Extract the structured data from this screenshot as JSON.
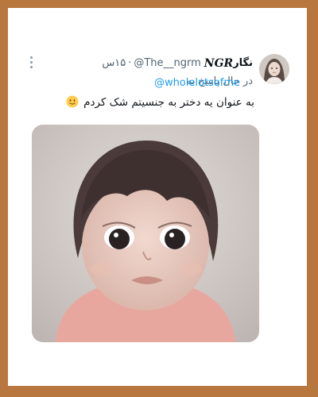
{
  "tweet": {
    "display_name_fa": "نگار",
    "display_name_latin": "NGR",
    "handle": "@The__ngrm",
    "separator": "·",
    "time": "۱۵س",
    "reply_prefix": "در حال پاسخ به",
    "reply_to": "@wholelotsofme",
    "text": "به عنوان یه دختر به جنسیتم شک کردم",
    "emoji": "slightly-smiling-face",
    "media_alt": "photo of a toddler with bangs and big eyes"
  },
  "colors": {
    "frame": "#b8773f",
    "card": "#ffffff",
    "text": "#0f1419",
    "secondary": "#536471",
    "link": "#1d9bf0"
  }
}
